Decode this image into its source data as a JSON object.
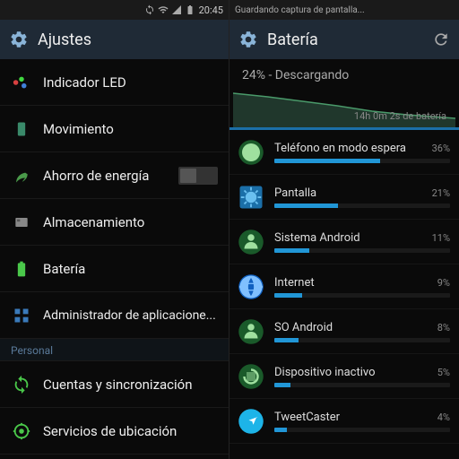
{
  "left": {
    "status": {
      "time": "20:45"
    },
    "header": {
      "title": "Ajustes"
    },
    "items": [
      {
        "label": "Indicador LED"
      },
      {
        "label": "Movimiento"
      },
      {
        "label": "Ahorro de energía",
        "toggle": true
      },
      {
        "label": "Almacenamiento"
      },
      {
        "label": "Batería"
      },
      {
        "label": "Administrador de aplicacione..."
      }
    ],
    "section": "Personal",
    "items2": [
      {
        "label": "Cuentas y sincronización"
      },
      {
        "label": "Servicios de ubicación"
      }
    ]
  },
  "right": {
    "status": {
      "text": "Guardando captura de pantalla..."
    },
    "header": {
      "title": "Batería"
    },
    "summary": "24% - Descargando",
    "graph_label": "14h 0m 2s de batería",
    "usage": [
      {
        "name": "Teléfono en modo espera",
        "pct": "36%",
        "fill": 60,
        "color": "#1a5a2a"
      },
      {
        "name": "Pantalla",
        "pct": "21%",
        "fill": 36,
        "color": "#1b6fa8"
      },
      {
        "name": "Sistema Android",
        "pct": "11%",
        "fill": 20,
        "color": "#1a5a2a"
      },
      {
        "name": "Internet",
        "pct": "9%",
        "fill": 16,
        "color": "#1060c0"
      },
      {
        "name": "SO Android",
        "pct": "8%",
        "fill": 14,
        "color": "#1a5a2a"
      },
      {
        "name": "Dispositivo inactivo",
        "pct": "5%",
        "fill": 9,
        "color": "#1a5a2a"
      },
      {
        "name": "TweetCaster",
        "pct": "4%",
        "fill": 7,
        "color": "#1db4e8"
      }
    ]
  }
}
